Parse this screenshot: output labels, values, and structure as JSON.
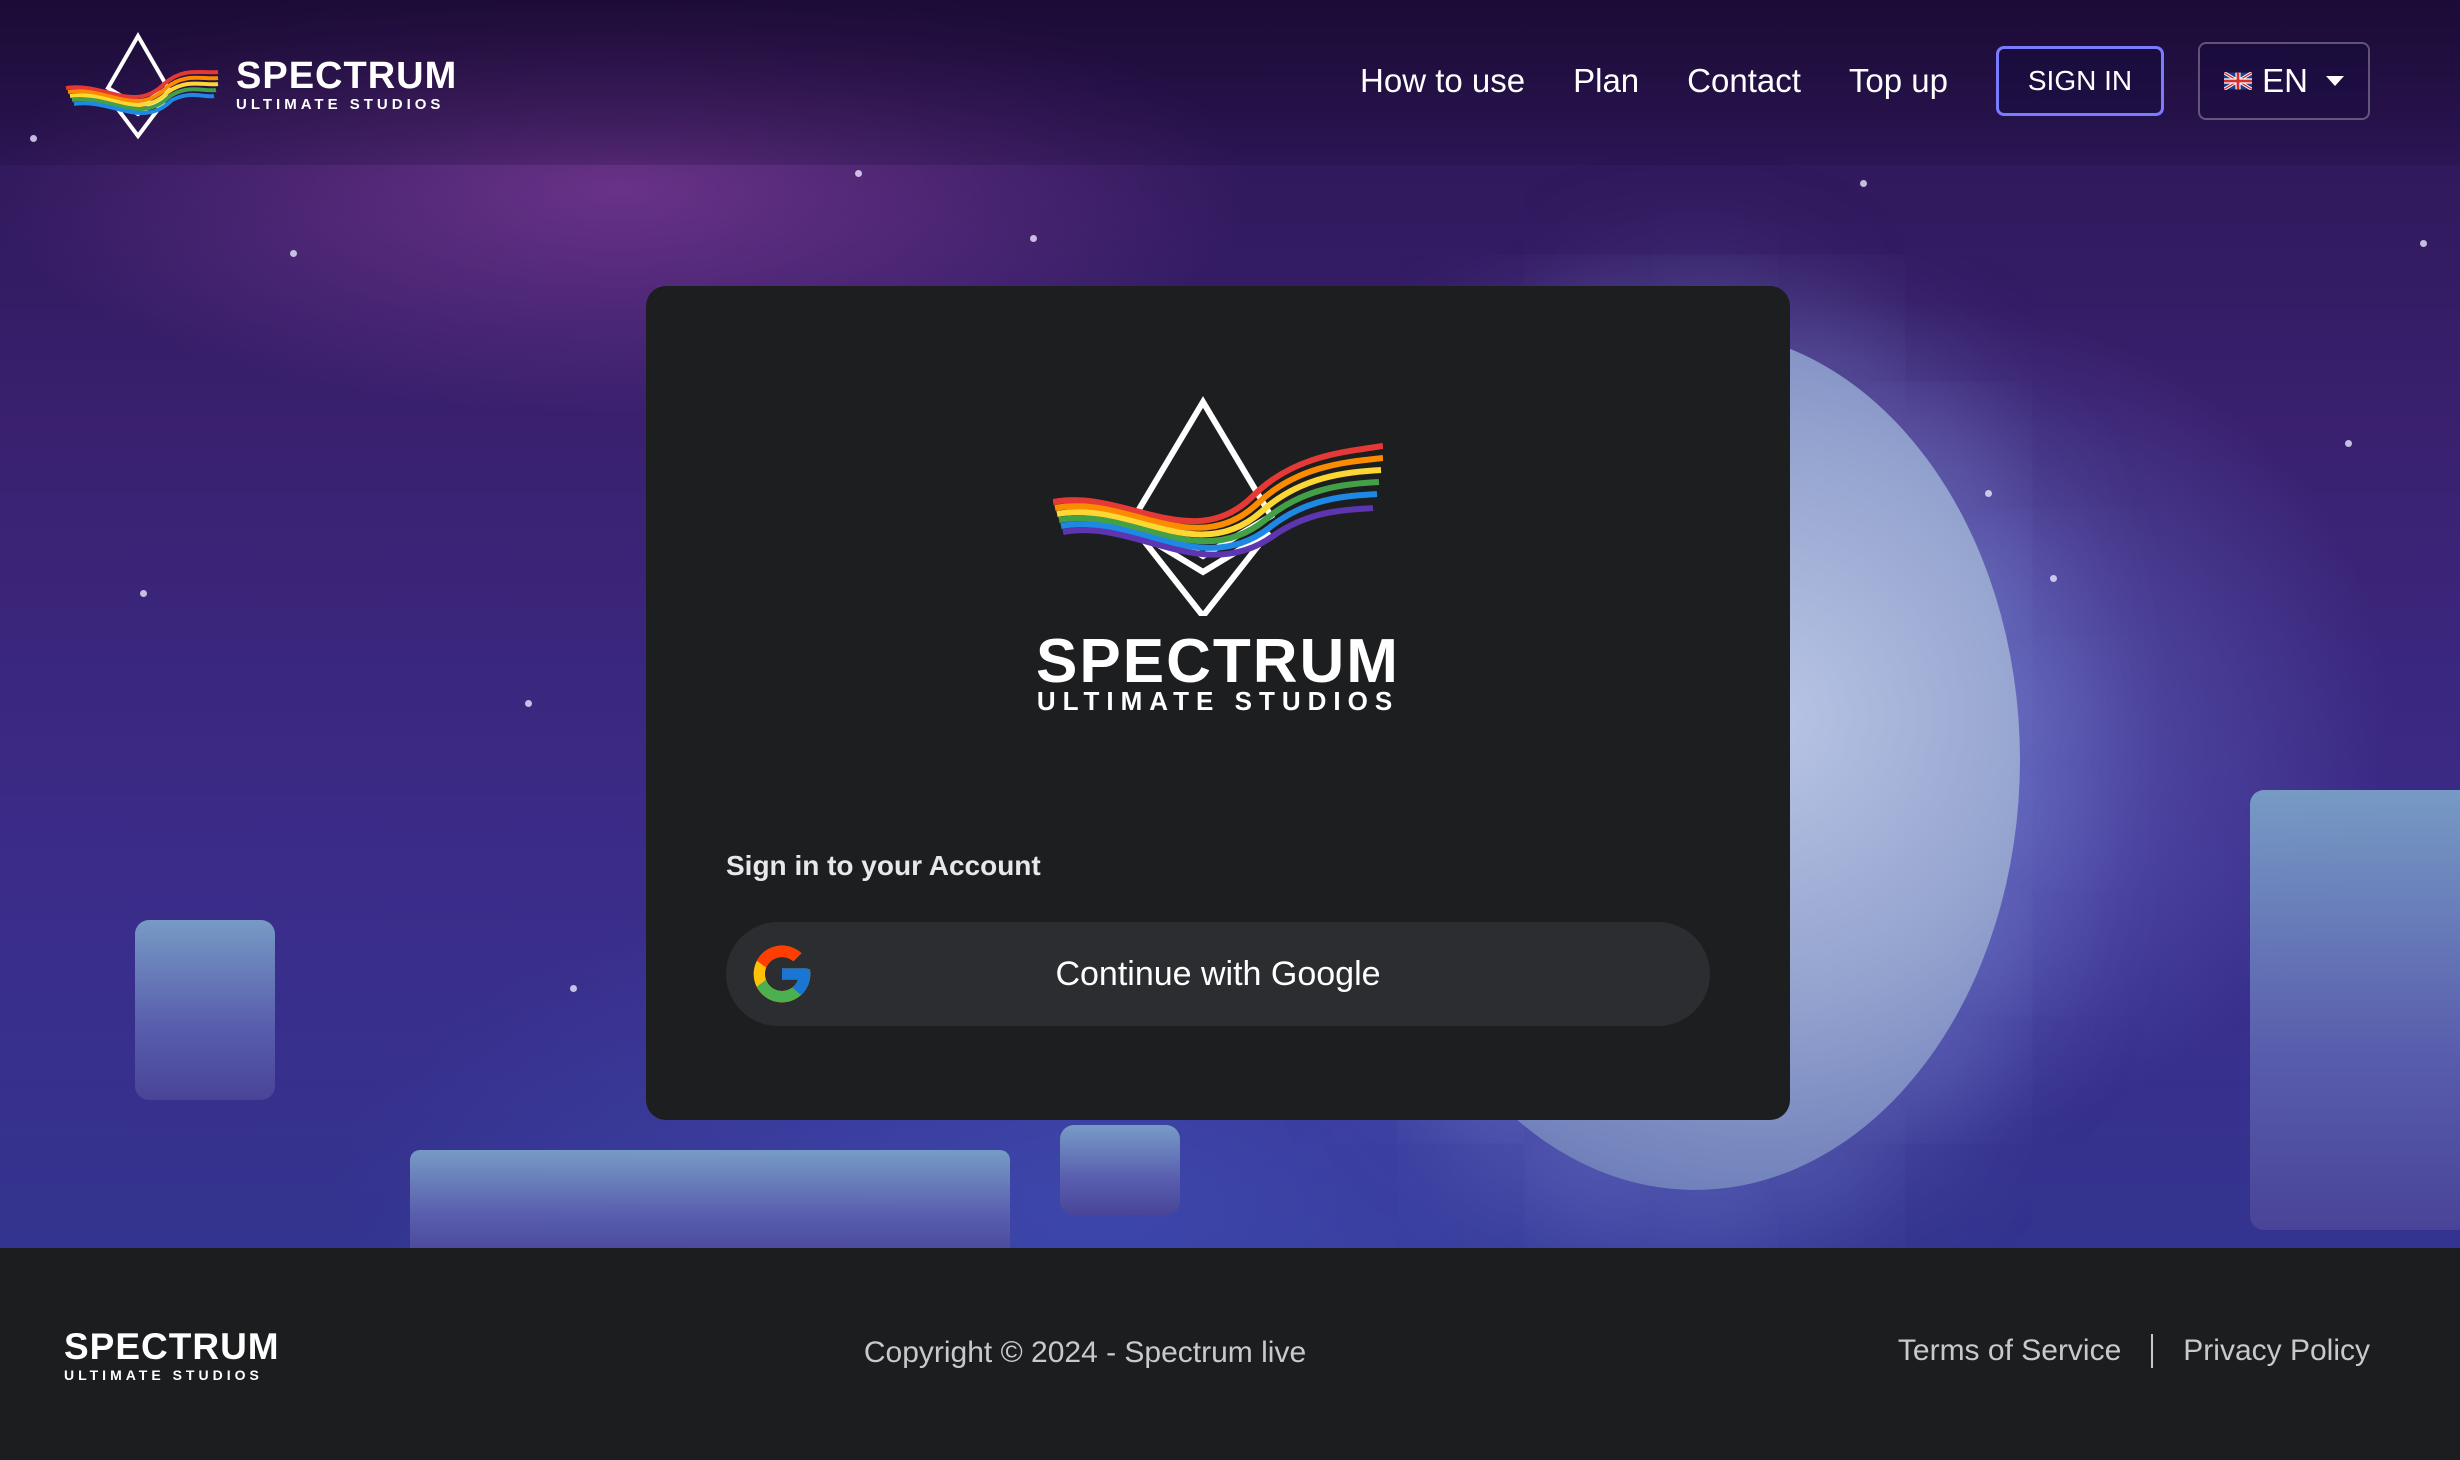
{
  "header": {
    "brand_name": "SPECTRUM",
    "brand_sub": "ULTIMATE STUDIOS",
    "nav": [
      "How to use",
      "Plan",
      "Contact",
      "Top up"
    ],
    "signin_label": "SIGN IN",
    "language": "EN",
    "flag_icon": "uk-flag-icon"
  },
  "card": {
    "brand_name": "SPECTRUM",
    "brand_sub": "ULTIMATE STUDIOS",
    "signin_title": "Sign in to your Account",
    "google_label": "Continue with Google",
    "google_icon": "google-icon"
  },
  "footer": {
    "brand_name": "SPECTRUM",
    "brand_sub": "ULTIMATE STUDIOS",
    "copyright": "Copyright © 2024 - Spectrum live",
    "links": [
      "Terms of Service",
      "Privacy Policy"
    ]
  },
  "colors": {
    "accent": "#7a7cff",
    "card_bg": "#1d1e20",
    "button_bg": "#2c2d30",
    "footer_bg": "#1c1d1f"
  }
}
